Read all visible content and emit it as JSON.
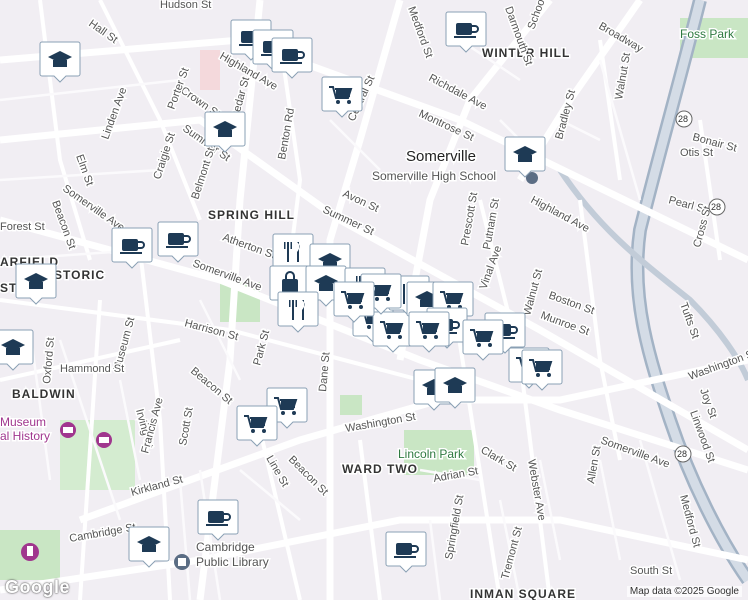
{
  "map": {
    "city_label": "Somerville",
    "neighborhoods": [
      "WINTER HILL",
      "SPRING HILL",
      "BALDWIN",
      "WARD TWO",
      "INMAN SQUARE",
      "MUSEUM",
      "Foss Park"
    ],
    "streets": {
      "hall": "Hall St",
      "hudson": "Hudson St",
      "medford": "Medford St",
      "darmouth": "Darmouth St",
      "school": "School St",
      "broadway": "Broadway",
      "highland_left": "Highland Ave",
      "highland_right": "Highland Ave",
      "richdale": "Richdale Ave",
      "montrose": "Montrose St",
      "central": "Central St",
      "crown": "Crown St",
      "linden": "Linden Ave",
      "porter": "Porter St",
      "cedar": "Cedar St",
      "summer_left": "Summer St",
      "summer_mid": "Summer St",
      "elm": "Elm St",
      "craigie": "Craigie St",
      "belmont": "Belmont St",
      "benton": "Benton Rd",
      "avon": "Avon St",
      "prescott": "Prescott St",
      "putnam": "Putnam St",
      "vinal": "Vinal Ave",
      "walnut_top": "Walnut St",
      "walnut_mid": "Walnut St",
      "bradley": "Bradley St",
      "otis": "Otis St",
      "bonair": "Bonair St",
      "pearl": "Pearl St",
      "cross": "Cross St",
      "boston": "Boston St",
      "munroe": "Munroe St",
      "tufts": "Tufts St",
      "washington_right": "Washington St",
      "washington_mid": "Washington St",
      "joy": "Joy St",
      "linwood": "Linwood St",
      "somerville_ave_left": "Somerville Ave",
      "somerville_ave_mid": "Somerville Ave",
      "somerville_ave_right": "Somerville Ave",
      "beacon_left": "Beacon St",
      "beacon_mid": "Beacon St",
      "beacon_low": "Beacon St",
      "atherton": "Atherton St",
      "harrison": "Harrison St",
      "park": "Park St",
      "dane": "Dane St",
      "museum_st": "Museum St",
      "hammond": "Hammond St",
      "oxford": "Oxford St",
      "irving": "Irving St",
      "francis": "Francis Ave",
      "scott": "Scott St",
      "kirkland": "Kirkland St",
      "line": "Line St",
      "clark": "Clark St",
      "adrian": "Adrian St",
      "allen": "Allen St",
      "webster": "Webster Ave",
      "tremont": "Tremont St",
      "springfield": "Springfield St",
      "cambridge": "Cambridge St",
      "south": "South St",
      "medford_low": "Medford St",
      "forest": "Forest St"
    },
    "pois": {
      "high_school": "Somerville High School",
      "museum_line1": "Museum",
      "museum_line2": "al History",
      "library_line1": "Cambridge",
      "library_line2": "Public Library",
      "lincoln_park": "Lincoln Park",
      "garfield": "ARFIELD",
      "historic": "HISTORIC",
      "east": "ST"
    },
    "routes": [
      "28",
      "28",
      "28"
    ],
    "attribution": "Map data ©2025 Google",
    "logo": "Google",
    "colors": {
      "marker_fill": "#1e3a55",
      "marker_bg": "#ffffff",
      "road_major": "#ffffff",
      "park": "#c9e6c4",
      "water": "#aadaff",
      "highway": "#a3b3c5"
    },
    "markers": [
      {
        "type": "cafe-icon"
      },
      {
        "type": "cafe-icon"
      },
      {
        "type": "cafe-icon"
      },
      {
        "type": "cafe-icon"
      },
      {
        "type": "school-icon"
      },
      {
        "type": "school-icon"
      },
      {
        "type": "grocery-icon"
      },
      {
        "type": "school-icon"
      },
      {
        "type": "cafe-icon"
      },
      {
        "type": "cafe-icon"
      },
      {
        "type": "school-icon"
      },
      {
        "type": "restaurant-icon"
      },
      {
        "type": "school-icon"
      },
      {
        "type": "shopping-icon"
      },
      {
        "type": "school-icon"
      },
      {
        "type": "restaurant-icon"
      },
      {
        "type": "restaurant-icon"
      },
      {
        "type": "grocery-icon"
      },
      {
        "type": "grocery-icon"
      },
      {
        "type": "restaurant-icon"
      },
      {
        "type": "grocery-icon"
      },
      {
        "type": "grocery-icon"
      },
      {
        "type": "school-icon"
      },
      {
        "type": "grocery-icon"
      },
      {
        "type": "cafe-icon"
      },
      {
        "type": "grocery-icon"
      },
      {
        "type": "cafe-icon"
      },
      {
        "type": "grocery-icon"
      },
      {
        "type": "grocery-icon"
      },
      {
        "type": "school-icon"
      },
      {
        "type": "school-icon"
      },
      {
        "type": "grocery-icon"
      },
      {
        "type": "grocery-icon"
      },
      {
        "type": "grocery-icon"
      },
      {
        "type": "cafe-icon"
      },
      {
        "type": "school-icon"
      },
      {
        "type": "cafe-icon"
      },
      {
        "type": "school-icon"
      }
    ]
  }
}
